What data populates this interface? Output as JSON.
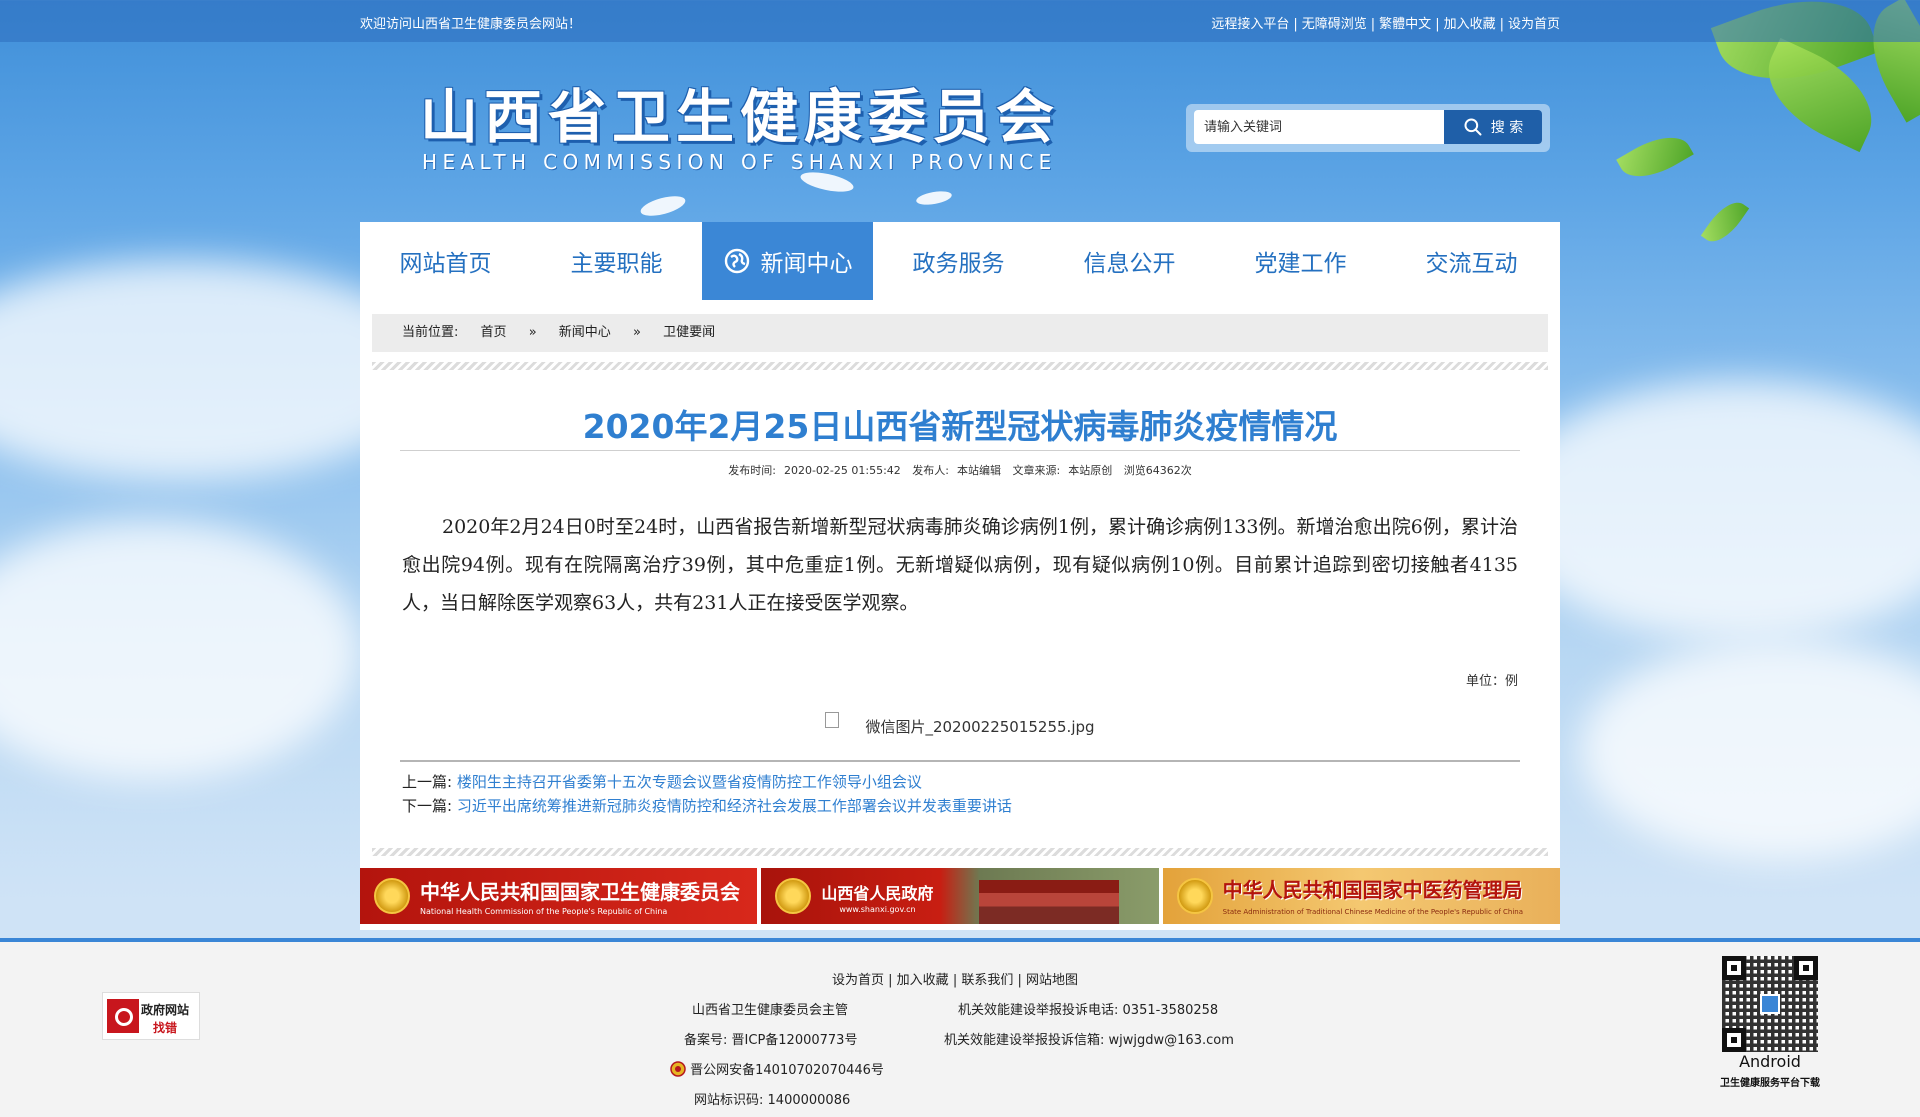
{
  "topbar": {
    "welcome": "欢迎访问山西省卫生健康委员会网站！",
    "links": [
      "远程接入平台",
      "无障碍浏览",
      "繁體中文",
      "加入收藏",
      "设为首页"
    ]
  },
  "logo": {
    "cn": "山西省卫生健康委员会",
    "en": "HEALTH COMMISSION OF SHANXI PROVINCE"
  },
  "search": {
    "placeholder": "请输入关键词",
    "button": "搜 索"
  },
  "nav": {
    "items": [
      "网站首页",
      "主要职能",
      "新闻中心",
      "政务服务",
      "信息公开",
      "党建工作",
      "交流互动"
    ],
    "active_index": 2
  },
  "breadcrumb": {
    "label": "当前位置:",
    "items": [
      "首页",
      "新闻中心",
      "卫健要闻"
    ],
    "sep": "»"
  },
  "article": {
    "title": "2020年2月25日山西省新型冠状病毒肺炎疫情情况",
    "meta": {
      "time_label": "发布时间:",
      "time": "2020-02-25 01:55:42",
      "publisher_label": "发布人:",
      "publisher": "本站编辑",
      "source_label": "文章来源:",
      "source": "本站原创",
      "views": "浏览64362次"
    },
    "body": "2020年2月24日0时至24时，山西省报告新增新型冠状病毒肺炎确诊病例1例，累计确诊病例133例。新增治愈出院6例，累计治愈出院94例。现有在院隔离治疗39例，其中危重症1例。无新增疑似病例，现有疑似病例10例。目前累计追踪到密切接触者4135人，当日解除医学观察63人，共有231人正在接受医学观察。",
    "unit": "单位：例",
    "image_alt": "微信图片_20200225015255.jpg",
    "prev_label": "上一篇:",
    "prev": "楼阳生主持召开省委第十五次专题会议暨省疫情防控工作领导小组会议",
    "next_label": "下一篇:",
    "next": "习近平出席统筹推进新冠肺炎疫情防控和经济社会发展工作部署会议并发表重要讲话"
  },
  "banners": [
    {
      "title": "中华人民共和国国家卫生健康委员会",
      "sub": "National Health Commission of the People's Republic of China"
    },
    {
      "title": "山西省人民政府",
      "sub": "www.shanxi.gov.cn"
    },
    {
      "title": "中华人民共和国国家中医药管理局",
      "sub": "State Administration of Traditional Chinese Medicine of the People's Republic of China"
    }
  ],
  "footer": {
    "links": [
      "设为首页",
      "加入收藏",
      "联系我们",
      "网站地图"
    ],
    "sponsor": "山西省卫生健康委员会主管",
    "phone_label": "机关效能建设举报投诉电话:",
    "phone": "0351-3580258",
    "icp_label": "备案号:",
    "icp": "晋ICP备12000773号",
    "email_label": "机关效能建设举报投诉信箱:",
    "email": "wjwjgdw@163.com",
    "police": "晋公网安备14010702070446号",
    "site_id_label": "网站标识码:",
    "site_id": "1400000086",
    "gov_badge_line1": "政府网站",
    "gov_badge_line2": "找错",
    "android": "Android",
    "qr_caption": "卫生健康服务平台下载"
  },
  "colors": {
    "accent": "#2f7fd0",
    "nav_active": "#3b87d6",
    "search_button": "#1f5fa8",
    "footer_border": "#3a86d6"
  }
}
